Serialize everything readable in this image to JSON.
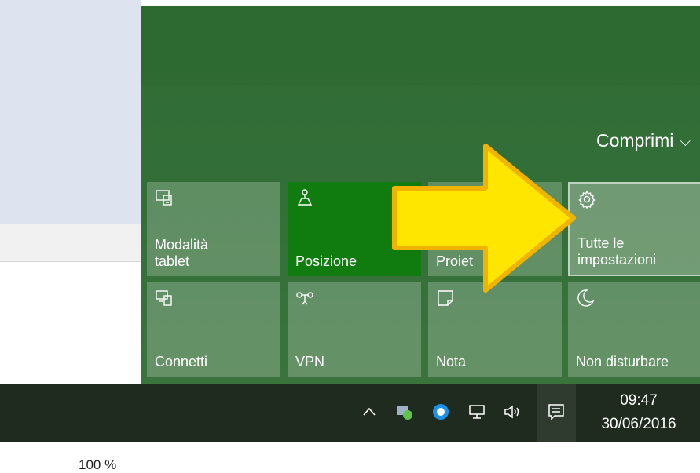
{
  "background_app": {
    "zoom": "100 %"
  },
  "action_center": {
    "collapse_label": "Comprimi",
    "tiles": [
      {
        "label": "Modalità\ntablet",
        "icon": "tablet-mode-icon",
        "state": "normal"
      },
      {
        "label": "Posizione",
        "icon": "location-icon",
        "state": "active"
      },
      {
        "label": "Proiet",
        "icon": "project-icon",
        "state": "normal"
      },
      {
        "label": "Tutte le\nimpostazioni",
        "icon": "gear-icon",
        "state": "selected"
      },
      {
        "label": "Connetti",
        "icon": "connect-icon",
        "state": "normal"
      },
      {
        "label": "VPN",
        "icon": "vpn-icon",
        "state": "normal"
      },
      {
        "label": "Nota",
        "icon": "note-icon",
        "state": "normal"
      },
      {
        "label": "Non disturbare",
        "icon": "moon-icon",
        "state": "normal"
      }
    ]
  },
  "taskbar": {
    "time": "09:47",
    "date": "30/06/2016",
    "tray_icons": [
      "chevron-up-icon",
      "app-tray-icon",
      "skype-icon",
      "network-icon",
      "volume-icon",
      "notification-icon"
    ]
  },
  "colors": {
    "accent": "#107c10",
    "panel": "#326e37",
    "arrow": "#ffe600"
  }
}
